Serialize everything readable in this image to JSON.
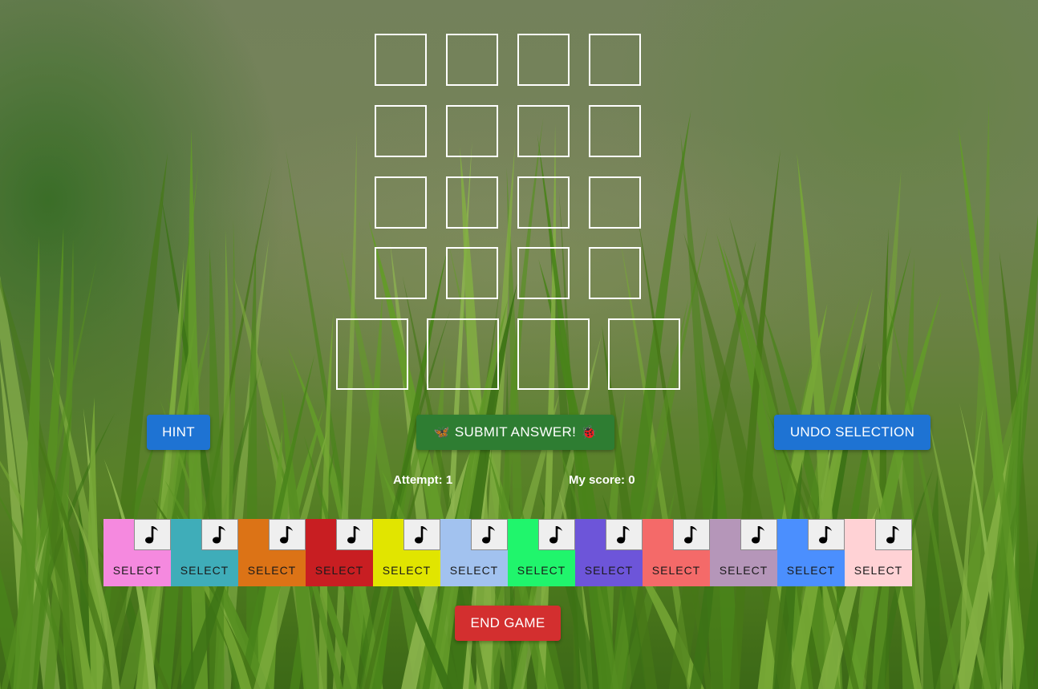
{
  "buttons": {
    "hint": "HINT",
    "submit": "SUBMIT ANSWER!",
    "submit_emoji_left": "🦋",
    "submit_emoji_right": "🐞",
    "undo": "UNDO SELECTION",
    "end_game": "END GAME"
  },
  "stats": {
    "attempt": "Attempt: 1",
    "score": "My score: 0"
  },
  "tiles": [
    {
      "color": "#f589df",
      "label": "SELECT",
      "icon": "music-note-icon"
    },
    {
      "color": "#3fadb9",
      "label": "SELECT",
      "icon": "music-note-icon"
    },
    {
      "color": "#dc7316",
      "label": "SELECT",
      "icon": "music-note-icon"
    },
    {
      "color": "#c81e22",
      "label": "SELECT",
      "icon": "music-note-icon"
    },
    {
      "color": "#e1e500",
      "label": "SELECT",
      "icon": "music-note-icon"
    },
    {
      "color": "#a2c2ef",
      "label": "SELECT",
      "icon": "music-note-icon"
    },
    {
      "color": "#20f56c",
      "label": "SELECT",
      "icon": "music-note-icon"
    },
    {
      "color": "#6d55d9",
      "label": "SELECT",
      "icon": "music-note-icon"
    },
    {
      "color": "#f46a69",
      "label": "SELECT",
      "icon": "music-note-icon"
    },
    {
      "color": "#b596b9",
      "label": "SELECT",
      "icon": "music-note-icon"
    },
    {
      "color": "#4b8ffe",
      "label": "SELECT",
      "icon": "music-note-icon"
    },
    {
      "color": "#ffd2d5",
      "label": "SELECT",
      "icon": "music-note-icon"
    }
  ],
  "colors": {
    "grid_border": "#ffffff",
    "hint_button": "#1e73d3",
    "undo_button": "#1e73d3",
    "submit_button": "#2e7d32",
    "end_game_button": "#d32f2f"
  }
}
